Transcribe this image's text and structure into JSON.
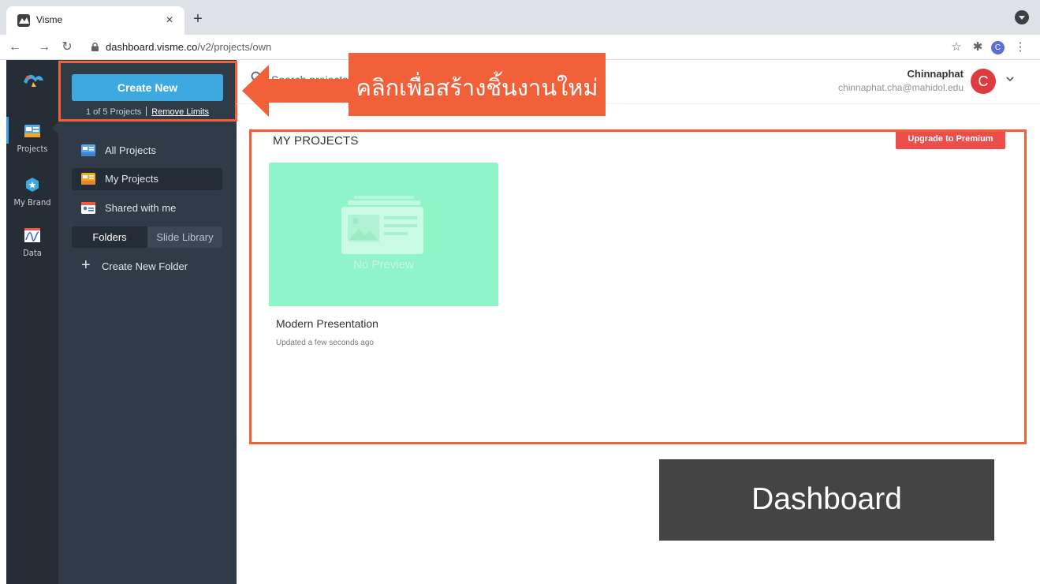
{
  "browser": {
    "tab_title": "Visme",
    "tab_close": "×",
    "new_tab": "+",
    "url_host": "dashboard.visme.co",
    "url_path": "/v2/projects/own",
    "profile_initial": "C"
  },
  "rail": {
    "items": [
      {
        "label": "Projects",
        "icon": "projects-icon"
      },
      {
        "label": "My Brand",
        "icon": "brand-icon"
      },
      {
        "label": "Data",
        "icon": "data-icon"
      }
    ]
  },
  "sidebar": {
    "create_label": "Create New",
    "limits_text": "1 of 5 Projects",
    "remove_limits": "Remove Limits",
    "items": [
      {
        "label": "All Projects"
      },
      {
        "label": "My Projects"
      },
      {
        "label": "Shared with me"
      }
    ],
    "segment": {
      "folders": "Folders",
      "slide_library": "Slide Library"
    },
    "create_folder": "Create New Folder"
  },
  "header": {
    "search_placeholder": "Search projects",
    "user_name": "Chinnaphat",
    "user_email": "chinnaphat.cha@mahidol.edu",
    "avatar_initial": "C"
  },
  "main": {
    "section_title": "MY PROJECTS",
    "upgrade_label": "Upgrade to Premium",
    "card": {
      "no_preview": "No Preview",
      "name": "Modern Presentation",
      "updated": "Updated a few seconds ago"
    }
  },
  "annotations": {
    "callout": "คลิกเพื่อสร้างชิ้นงานใหม่",
    "dashboard": "Dashboard"
  },
  "colors": {
    "accent": "#3ea9e0",
    "highlight": "#f2603a",
    "upgrade": "#ee4e4b",
    "card": "#8ff4c6"
  }
}
